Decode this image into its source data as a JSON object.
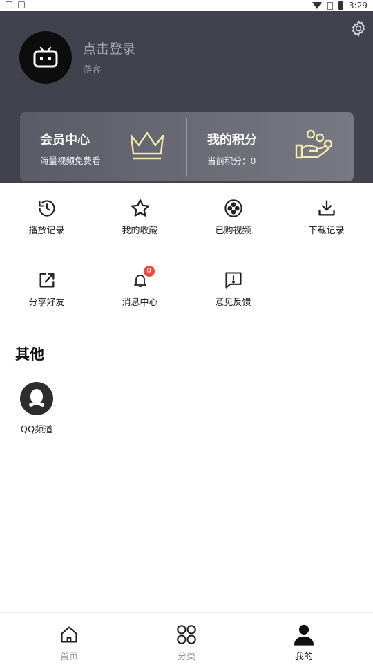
{
  "status_bar": {
    "time": "3:29",
    "icons": [
      "image-icon",
      "notification-icon",
      "wifi-icon",
      "sim-icon",
      "battery-icon"
    ]
  },
  "profile": {
    "login_label": "点击登录",
    "subtitle": "游客"
  },
  "cards": {
    "member": {
      "title": "会员中心",
      "subtitle": "海量视频免费看",
      "icon": "crown-icon"
    },
    "points": {
      "title": "我的积分",
      "subtitle": "当前积分：0",
      "icon": "coin-hand-icon"
    }
  },
  "grid": {
    "history": {
      "label": "播放记录",
      "icon": "history-icon"
    },
    "favorites": {
      "label": "我的收藏",
      "icon": "star-icon"
    },
    "purchased": {
      "label": "已购视频",
      "icon": "film-reel-icon"
    },
    "downloads": {
      "label": "下载记录",
      "icon": "download-icon"
    },
    "share": {
      "label": "分享好友",
      "icon": "share-icon"
    },
    "messages": {
      "label": "消息中心",
      "icon": "bell-icon",
      "badge": "0"
    },
    "feedback": {
      "label": "意见反馈",
      "icon": "feedback-icon"
    }
  },
  "other": {
    "title": "其他",
    "qq_label": "QQ频道"
  },
  "tabs": {
    "home": "首页",
    "category": "分类",
    "mine": "我的"
  },
  "colors": {
    "header_bg": "#42424f",
    "card_accent": "#f3eab0",
    "badge": "#f24a3f",
    "tab_active": "#111111",
    "tab_inactive": "#999999"
  }
}
